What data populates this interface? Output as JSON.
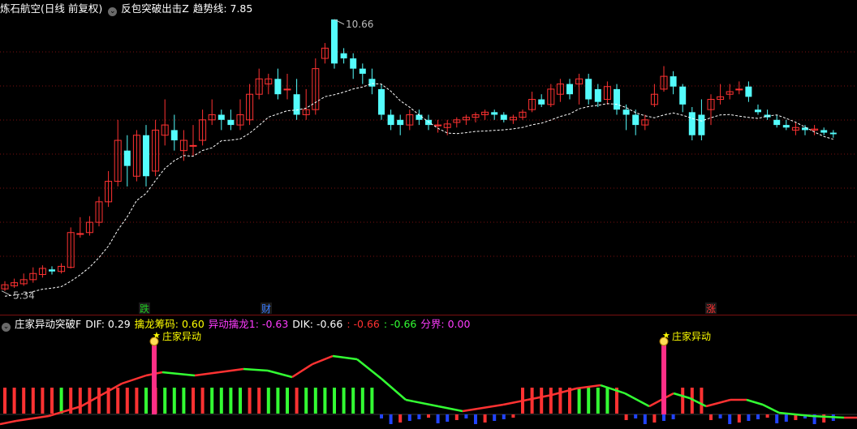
{
  "main_header": {
    "stock_title": "炼石航空(日线 前复权)",
    "indicator_name": "反包突破出击Z",
    "trend_label": "趋势线: 7.85"
  },
  "main_chart": {
    "high_label": "10.66",
    "low_label": "5.34",
    "markers": [
      {
        "text": "跌",
        "color": "#22cc22"
      },
      {
        "text": "财",
        "color": "#3a7cff"
      },
      {
        "text": "涨",
        "color": "#ff3030"
      }
    ]
  },
  "sub_header": {
    "indicator_name": "庄家异动突破F",
    "dif": "DIF: 0.29",
    "chip": "擒龙筹码: 0.60",
    "yidong": "异动擒龙1: -0.63",
    "dik": "DIK: -0.66",
    "v1": ": -0.66",
    "v2": ": -0.66",
    "boundary": "分界: 0.00"
  },
  "signals": [
    {
      "text": "庄家异动"
    },
    {
      "text": "庄家异动"
    }
  ],
  "colors": {
    "up": "#ff3232",
    "down": "#54fcfc",
    "trend": "#ffffff",
    "grid": "#7a1010",
    "green": "#33ff33",
    "pink": "#ff2f86",
    "yellow": "#ffff00",
    "blue": "#2244ff"
  },
  "chart_data": {
    "type": "candlestick",
    "candles": [
      [
        5.4,
        5.48,
        5.55,
        5.36
      ],
      [
        5.46,
        5.52,
        5.6,
        5.42
      ],
      [
        5.5,
        5.58,
        5.7,
        5.46
      ],
      [
        5.58,
        5.7,
        5.82,
        5.52
      ],
      [
        5.68,
        5.8,
        5.86,
        5.62
      ],
      [
        5.78,
        5.74,
        5.84,
        5.68
      ],
      [
        5.74,
        5.84,
        5.9,
        5.7
      ],
      [
        5.82,
        6.5,
        6.6,
        5.8
      ],
      [
        6.48,
        6.48,
        6.8,
        6.4
      ],
      [
        6.5,
        6.7,
        6.82,
        6.44
      ],
      [
        6.7,
        7.1,
        7.2,
        6.62
      ],
      [
        7.1,
        7.5,
        7.7,
        7.0
      ],
      [
        7.5,
        8.3,
        8.7,
        7.4
      ],
      [
        8.1,
        7.8,
        8.4,
        7.4
      ],
      [
        7.6,
        8.4,
        8.5,
        7.5
      ],
      [
        8.4,
        7.6,
        8.6,
        7.4
      ],
      [
        7.7,
        8.5,
        8.7,
        7.6
      ],
      [
        8.4,
        8.6,
        9.1,
        8.2
      ],
      [
        8.5,
        8.3,
        8.8,
        8.1
      ],
      [
        8.1,
        8.3,
        8.5,
        7.9
      ],
      [
        8.2,
        8.2,
        8.6,
        8.0
      ],
      [
        8.3,
        8.7,
        8.9,
        8.2
      ],
      [
        8.7,
        8.8,
        9.1,
        8.6
      ],
      [
        8.8,
        8.7,
        8.9,
        8.5
      ],
      [
        8.7,
        8.6,
        8.9,
        8.5
      ],
      [
        8.6,
        8.8,
        9.1,
        8.5
      ],
      [
        8.7,
        9.2,
        9.4,
        8.6
      ],
      [
        9.2,
        9.5,
        9.7,
        9.1
      ],
      [
        9.4,
        9.5,
        9.6,
        9.2
      ],
      [
        9.5,
        9.2,
        9.7,
        9.1
      ],
      [
        9.3,
        9.3,
        9.6,
        9.1
      ],
      [
        9.2,
        8.8,
        9.5,
        8.7
      ],
      [
        8.8,
        8.9,
        9.3,
        8.7
      ],
      [
        8.9,
        9.7,
        9.9,
        8.8
      ],
      [
        9.9,
        10.1,
        10.2,
        9.8
      ],
      [
        10.66,
        9.8,
        10.66,
        9.7
      ],
      [
        10.0,
        9.9,
        10.1,
        9.8
      ],
      [
        9.9,
        9.7,
        10.0,
        9.5
      ],
      [
        9.7,
        9.6,
        9.8,
        9.4
      ],
      [
        9.5,
        9.35,
        9.7,
        9.2
      ],
      [
        9.3,
        8.8,
        9.4,
        8.7
      ],
      [
        8.8,
        8.6,
        8.9,
        8.5
      ],
      [
        8.7,
        8.6,
        8.8,
        8.4
      ],
      [
        8.6,
        8.8,
        8.9,
        8.5
      ],
      [
        8.8,
        8.7,
        8.9,
        8.6
      ],
      [
        8.7,
        8.6,
        8.8,
        8.5
      ],
      [
        8.6,
        8.6,
        8.7,
        8.45
      ],
      [
        8.55,
        8.62,
        8.7,
        8.4
      ],
      [
        8.65,
        8.7,
        8.75,
        8.55
      ],
      [
        8.7,
        8.75,
        8.8,
        8.6
      ],
      [
        8.75,
        8.8,
        8.85,
        8.65
      ],
      [
        8.8,
        8.85,
        8.9,
        8.7
      ],
      [
        8.85,
        8.8,
        8.9,
        8.7
      ],
      [
        8.8,
        8.7,
        8.85,
        8.65
      ],
      [
        8.7,
        8.75,
        8.8,
        8.62
      ],
      [
        8.75,
        8.85,
        8.9,
        8.7
      ],
      [
        8.9,
        9.1,
        9.25,
        8.85
      ],
      [
        9.1,
        9.0,
        9.2,
        8.95
      ],
      [
        9.0,
        9.3,
        9.4,
        8.95
      ],
      [
        9.2,
        9.4,
        9.5,
        9.05
      ],
      [
        9.4,
        9.2,
        9.5,
        9.1
      ],
      [
        9.4,
        9.5,
        9.6,
        9.0
      ],
      [
        9.5,
        9.1,
        9.6,
        9.0
      ],
      [
        9.3,
        9.05,
        9.4,
        8.95
      ],
      [
        9.1,
        9.35,
        9.45,
        9.0
      ],
      [
        9.3,
        8.9,
        9.4,
        8.8
      ],
      [
        8.9,
        8.8,
        9.0,
        8.5
      ],
      [
        8.8,
        8.6,
        8.9,
        8.4
      ],
      [
        8.6,
        8.7,
        8.8,
        8.5
      ],
      [
        9.0,
        9.2,
        9.4,
        8.95
      ],
      [
        9.3,
        9.55,
        9.75,
        9.25
      ],
      [
        9.55,
        9.35,
        9.65,
        9.2
      ],
      [
        9.35,
        9.0,
        9.4,
        8.85
      ],
      [
        8.85,
        8.4,
        8.95,
        8.3
      ],
      [
        8.8,
        8.4,
        9.1,
        8.3
      ],
      [
        8.9,
        9.1,
        9.2,
        8.6
      ],
      [
        9.1,
        9.15,
        9.4,
        9.0
      ],
      [
        9.2,
        9.25,
        9.4,
        9.1
      ],
      [
        9.3,
        9.3,
        9.45,
        9.2
      ],
      [
        9.35,
        9.15,
        9.45,
        9.05
      ],
      [
        8.9,
        8.85,
        9.0,
        8.8
      ],
      [
        8.8,
        8.75,
        8.9,
        8.7
      ],
      [
        8.7,
        8.6,
        8.8,
        8.55
      ],
      [
        8.6,
        8.55,
        8.7,
        8.5
      ],
      [
        8.5,
        8.55,
        8.65,
        8.4
      ],
      [
        8.55,
        8.5,
        8.6,
        8.4
      ],
      [
        8.5,
        8.52,
        8.6,
        8.4
      ],
      [
        8.5,
        8.45,
        8.55,
        8.4
      ],
      [
        8.45,
        8.42,
        8.5,
        8.35
      ]
    ]
  }
}
